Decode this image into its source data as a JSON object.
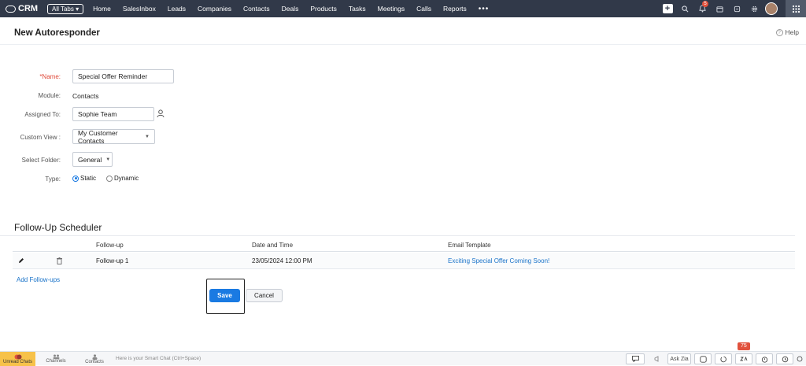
{
  "nav": {
    "brand": "CRM",
    "all_tabs": "All Tabs",
    "items": [
      "Home",
      "SalesInbox",
      "Leads",
      "Companies",
      "Contacts",
      "Deals",
      "Products",
      "Tasks",
      "Meetings",
      "Calls",
      "Reports"
    ],
    "more": "•••",
    "notification_count": "5"
  },
  "page": {
    "title": "New Autoresponder",
    "help": "Help"
  },
  "form": {
    "name_label": "*Name:",
    "name_value": "Special Offer Reminder",
    "module_label": "Module:",
    "module_value": "Contacts",
    "assigned_label": "Assigned To:",
    "assigned_value": "Sophie Team",
    "view_label": "Custom View :",
    "view_value": "My Customer Contacts",
    "folder_label": "Select Folder:",
    "folder_value": "General",
    "type_label": "Type:",
    "type_static": "Static",
    "type_dynamic": "Dynamic"
  },
  "scheduler": {
    "title": "Follow-Up Scheduler",
    "col_followup": "Follow-up",
    "col_datetime": "Date and Time",
    "col_template": "Email Template",
    "row": {
      "followup": "Follow-up 1",
      "datetime": "23/05/2024 12:00 PM",
      "template": "Exciting Special Offer Coming Soon!"
    },
    "add_link": "Add Follow-ups"
  },
  "actions": {
    "save": "Save",
    "cancel": "Cancel"
  },
  "bottom": {
    "unread": "Unread Chats",
    "channels": "Channels",
    "contacts": "Contacts",
    "smart_chat": "Here is your Smart Chat (Ctrl+Space)",
    "ask_zia": "Ask Zia",
    "badge": "75"
  },
  "colors": {
    "accent": "#1a7ae2",
    "nav_bg": "#313949",
    "required": "#e04a3a"
  }
}
